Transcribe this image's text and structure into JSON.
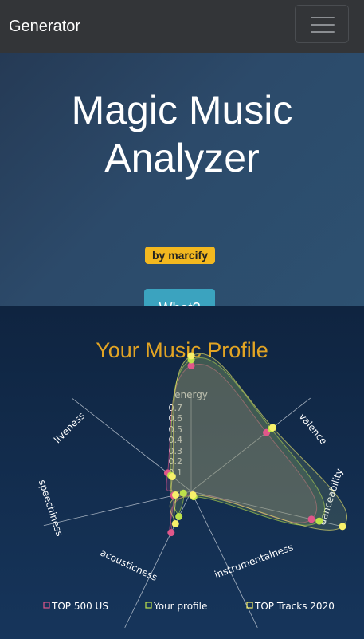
{
  "navbar": {
    "brand": "Generator",
    "menu_icon": "hamburger-icon"
  },
  "hero": {
    "title_line1": "Magic Music",
    "title_line2": "Analyzer",
    "badge": "by marcify",
    "button": "What?"
  },
  "profile": {
    "title": "Your Music Profile"
  },
  "chart_data": {
    "type": "radar",
    "axes": [
      "energy",
      "valence",
      "danceability",
      "instrumentalness",
      "acousticness",
      "speechiness",
      "liveness"
    ],
    "ticks": [
      "0.1",
      "0.2",
      "0.3",
      "0.4",
      "0.5",
      "0.6",
      "0.7"
    ],
    "rmax": 0.7,
    "series": [
      {
        "name": "TOP 500 US",
        "color": "#e0578a",
        "values": [
          0.63,
          0.48,
          0.62,
          0.02,
          0.23,
          0.09,
          0.15
        ]
      },
      {
        "name": "Your profile",
        "color": "#bde24a",
        "values": [
          0.66,
          0.51,
          0.66,
          0.03,
          0.14,
          0.04,
          0.13
        ]
      },
      {
        "name": "TOP Tracks 2020",
        "color": "#f7f06a",
        "values": [
          0.68,
          0.52,
          0.78,
          0.02,
          0.18,
          0.08,
          0.12
        ]
      }
    ],
    "legend_position": "bottom"
  }
}
